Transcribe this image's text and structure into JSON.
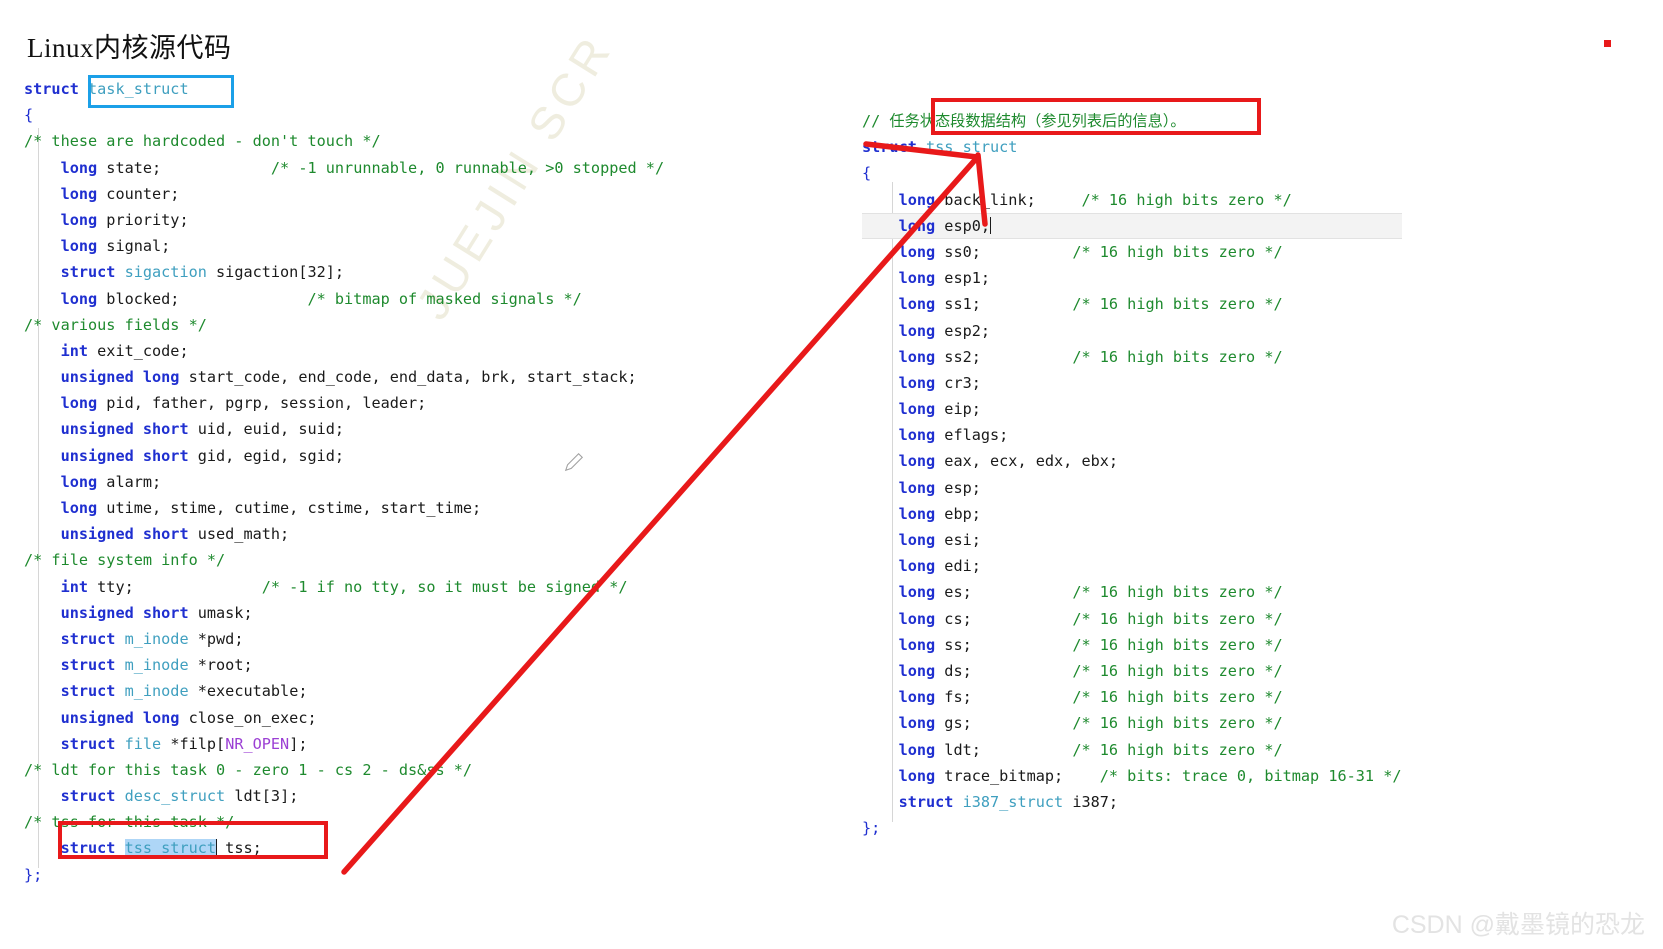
{
  "title": "Linux内核源代码",
  "colors": {
    "keyword": "#1f2fd0",
    "type": "#3f9fbf",
    "comment": "#1e8a2e",
    "macro": "#9b3fd4",
    "annotation_red": "#e8191a",
    "annotation_blue": "#1ba0e8",
    "selection": "#aed6f7"
  },
  "annotations": {
    "blue_box_target": "task_struct",
    "red_box_left_target": "struct tss_struct tss;",
    "red_box_right_target": "任务状态段数据结构（参见列表后的信息）。",
    "arrow": "red-arrow-from-tss-field-to-tss_struct-definition",
    "red_dot": "red-dot-marker"
  },
  "left_pane": {
    "name": "task_struct-source",
    "lines": [
      {
        "indent": 0,
        "segments": [
          {
            "t": "struct ",
            "c": "kw"
          },
          {
            "t": "task_struct",
            "c": "typ"
          }
        ]
      },
      {
        "indent": 0,
        "segments": [
          {
            "t": "{",
            "c": "br"
          }
        ]
      },
      {
        "indent": 0,
        "segments": [
          {
            "t": "/* these are hardcoded - don't touch */",
            "c": "cmt"
          }
        ]
      },
      {
        "indent": 1,
        "segments": [
          {
            "t": "long ",
            "c": "kw"
          },
          {
            "t": "state;",
            "c": "id"
          },
          {
            "t": "            ",
            "c": "id"
          },
          {
            "t": "/* -1 unrunnable, 0 runnable, >0 stopped */",
            "c": "cmt"
          }
        ]
      },
      {
        "indent": 1,
        "segments": [
          {
            "t": "long ",
            "c": "kw"
          },
          {
            "t": "counter;",
            "c": "id"
          }
        ]
      },
      {
        "indent": 1,
        "segments": [
          {
            "t": "long ",
            "c": "kw"
          },
          {
            "t": "priority;",
            "c": "id"
          }
        ]
      },
      {
        "indent": 1,
        "segments": [
          {
            "t": "long ",
            "c": "kw"
          },
          {
            "t": "signal;",
            "c": "id"
          }
        ]
      },
      {
        "indent": 1,
        "segments": [
          {
            "t": "struct ",
            "c": "kw"
          },
          {
            "t": "sigaction",
            "c": "typ"
          },
          {
            "t": " sigaction[",
            "c": "id"
          },
          {
            "t": "32",
            "c": "num"
          },
          {
            "t": "];",
            "c": "id"
          }
        ]
      },
      {
        "indent": 1,
        "segments": [
          {
            "t": "long ",
            "c": "kw"
          },
          {
            "t": "blocked;",
            "c": "id"
          },
          {
            "t": "              ",
            "c": "id"
          },
          {
            "t": "/* bitmap of masked signals */",
            "c": "cmt"
          }
        ]
      },
      {
        "indent": 0,
        "segments": [
          {
            "t": "/* various fields */",
            "c": "cmt"
          }
        ]
      },
      {
        "indent": 1,
        "segments": [
          {
            "t": "int ",
            "c": "kw"
          },
          {
            "t": "exit_code;",
            "c": "id"
          }
        ]
      },
      {
        "indent": 1,
        "segments": [
          {
            "t": "unsigned long ",
            "c": "kw"
          },
          {
            "t": "start_code, end_code, end_data, brk, start_stack;",
            "c": "id"
          }
        ]
      },
      {
        "indent": 1,
        "segments": [
          {
            "t": "long ",
            "c": "kw"
          },
          {
            "t": "pid, father, pgrp, session, leader;",
            "c": "id"
          }
        ]
      },
      {
        "indent": 1,
        "segments": [
          {
            "t": "unsigned short ",
            "c": "kw"
          },
          {
            "t": "uid, euid, suid;",
            "c": "id"
          }
        ]
      },
      {
        "indent": 1,
        "segments": [
          {
            "t": "unsigned short ",
            "c": "kw"
          },
          {
            "t": "gid, egid, sgid;",
            "c": "id"
          }
        ]
      },
      {
        "indent": 1,
        "segments": [
          {
            "t": "long ",
            "c": "kw"
          },
          {
            "t": "alarm;",
            "c": "id"
          }
        ]
      },
      {
        "indent": 1,
        "segments": [
          {
            "t": "long ",
            "c": "kw"
          },
          {
            "t": "utime, stime, cutime, cstime, start_time;",
            "c": "id"
          }
        ]
      },
      {
        "indent": 1,
        "segments": [
          {
            "t": "unsigned short ",
            "c": "kw"
          },
          {
            "t": "used_math;",
            "c": "id"
          }
        ]
      },
      {
        "indent": 0,
        "segments": [
          {
            "t": "/* file system info */",
            "c": "cmt"
          }
        ]
      },
      {
        "indent": 1,
        "segments": [
          {
            "t": "int ",
            "c": "kw"
          },
          {
            "t": "tty;",
            "c": "id"
          },
          {
            "t": "              ",
            "c": "id"
          },
          {
            "t": "/* -1 if no tty, so it must be signed */",
            "c": "cmt"
          }
        ]
      },
      {
        "indent": 1,
        "segments": [
          {
            "t": "unsigned short ",
            "c": "kw"
          },
          {
            "t": "umask;",
            "c": "id"
          }
        ]
      },
      {
        "indent": 1,
        "segments": [
          {
            "t": "struct ",
            "c": "kw"
          },
          {
            "t": "m_inode",
            "c": "typ"
          },
          {
            "t": " *pwd;",
            "c": "id"
          }
        ]
      },
      {
        "indent": 1,
        "segments": [
          {
            "t": "struct ",
            "c": "kw"
          },
          {
            "t": "m_inode",
            "c": "typ"
          },
          {
            "t": " *root;",
            "c": "id"
          }
        ]
      },
      {
        "indent": 1,
        "segments": [
          {
            "t": "struct ",
            "c": "kw"
          },
          {
            "t": "m_inode",
            "c": "typ"
          },
          {
            "t": " *executable;",
            "c": "id"
          }
        ]
      },
      {
        "indent": 1,
        "segments": [
          {
            "t": "unsigned long ",
            "c": "kw"
          },
          {
            "t": "close_on_exec;",
            "c": "id"
          }
        ]
      },
      {
        "indent": 1,
        "segments": [
          {
            "t": "struct ",
            "c": "kw"
          },
          {
            "t": "file",
            "c": "typ"
          },
          {
            "t": " *filp[",
            "c": "id"
          },
          {
            "t": "NR_OPEN",
            "c": "mac"
          },
          {
            "t": "];",
            "c": "id"
          }
        ]
      },
      {
        "indent": 0,
        "segments": [
          {
            "t": "/* ldt for this task 0 - zero 1 - cs 2 - ds&ss */",
            "c": "cmt"
          }
        ]
      },
      {
        "indent": 1,
        "segments": [
          {
            "t": "struct ",
            "c": "kw"
          },
          {
            "t": "desc_struct",
            "c": "typ"
          },
          {
            "t": " ldt[",
            "c": "id"
          },
          {
            "t": "3",
            "c": "num"
          },
          {
            "t": "];",
            "c": "id"
          }
        ]
      },
      {
        "indent": 0,
        "segments": [
          {
            "t": "/* tss for this task */",
            "c": "cmt"
          }
        ]
      },
      {
        "indent": 1,
        "segments": [
          {
            "t": "struct ",
            "c": "kw"
          },
          {
            "t": "tss_struct",
            "c": "typ sel"
          },
          {
            "t": "|caret|",
            "c": "caret"
          },
          {
            "t": " tss;",
            "c": "id"
          }
        ]
      },
      {
        "indent": 0,
        "segments": [
          {
            "t": "};",
            "c": "br"
          }
        ]
      }
    ]
  },
  "right_pane": {
    "name": "tss_struct-source",
    "lines": [
      {
        "indent": 0,
        "segments": [
          {
            "t": "// 任务状态段数据结构（参见列表后的信息）。",
            "c": "cmt"
          }
        ]
      },
      {
        "indent": 0,
        "segments": [
          {
            "t": "struct ",
            "c": "kw"
          },
          {
            "t": "tss_struct",
            "c": "typ"
          }
        ]
      },
      {
        "indent": 0,
        "segments": [
          {
            "t": "{",
            "c": "br"
          }
        ]
      },
      {
        "indent": 1,
        "segments": [
          {
            "t": "long ",
            "c": "kw"
          },
          {
            "t": "back_link;",
            "c": "id"
          },
          {
            "t": "     ",
            "c": "id"
          },
          {
            "t": "/* 16 high bits zero */",
            "c": "cmt"
          }
        ]
      },
      {
        "indent": 1,
        "current": true,
        "segments": [
          {
            "t": "long ",
            "c": "kw"
          },
          {
            "t": "esp0;",
            "c": "id"
          },
          {
            "t": "|caret|",
            "c": "caret"
          }
        ]
      },
      {
        "indent": 1,
        "segments": [
          {
            "t": "long ",
            "c": "kw"
          },
          {
            "t": "ss0;",
            "c": "id"
          },
          {
            "t": "          ",
            "c": "id"
          },
          {
            "t": "/* 16 high bits zero */",
            "c": "cmt"
          }
        ]
      },
      {
        "indent": 1,
        "segments": [
          {
            "t": "long ",
            "c": "kw"
          },
          {
            "t": "esp1;",
            "c": "id"
          }
        ]
      },
      {
        "indent": 1,
        "segments": [
          {
            "t": "long ",
            "c": "kw"
          },
          {
            "t": "ss1;",
            "c": "id"
          },
          {
            "t": "          ",
            "c": "id"
          },
          {
            "t": "/* 16 high bits zero */",
            "c": "cmt"
          }
        ]
      },
      {
        "indent": 1,
        "segments": [
          {
            "t": "long ",
            "c": "kw"
          },
          {
            "t": "esp2;",
            "c": "id"
          }
        ]
      },
      {
        "indent": 1,
        "segments": [
          {
            "t": "long ",
            "c": "kw"
          },
          {
            "t": "ss2;",
            "c": "id"
          },
          {
            "t": "          ",
            "c": "id"
          },
          {
            "t": "/* 16 high bits zero */",
            "c": "cmt"
          }
        ]
      },
      {
        "indent": 1,
        "segments": [
          {
            "t": "long ",
            "c": "kw"
          },
          {
            "t": "cr3;",
            "c": "id"
          }
        ]
      },
      {
        "indent": 1,
        "segments": [
          {
            "t": "long ",
            "c": "kw"
          },
          {
            "t": "eip;",
            "c": "id"
          }
        ]
      },
      {
        "indent": 1,
        "segments": [
          {
            "t": "long ",
            "c": "kw"
          },
          {
            "t": "eflags;",
            "c": "id"
          }
        ]
      },
      {
        "indent": 1,
        "segments": [
          {
            "t": "long ",
            "c": "kw"
          },
          {
            "t": "eax, ecx, edx, ebx;",
            "c": "id"
          }
        ]
      },
      {
        "indent": 1,
        "segments": [
          {
            "t": "long ",
            "c": "kw"
          },
          {
            "t": "esp;",
            "c": "id"
          }
        ]
      },
      {
        "indent": 1,
        "segments": [
          {
            "t": "long ",
            "c": "kw"
          },
          {
            "t": "ebp;",
            "c": "id"
          }
        ]
      },
      {
        "indent": 1,
        "segments": [
          {
            "t": "long ",
            "c": "kw"
          },
          {
            "t": "esi;",
            "c": "id"
          }
        ]
      },
      {
        "indent": 1,
        "segments": [
          {
            "t": "long ",
            "c": "kw"
          },
          {
            "t": "edi;",
            "c": "id"
          }
        ]
      },
      {
        "indent": 1,
        "segments": [
          {
            "t": "long ",
            "c": "kw"
          },
          {
            "t": "es;",
            "c": "id"
          },
          {
            "t": "           ",
            "c": "id"
          },
          {
            "t": "/* 16 high bits zero */",
            "c": "cmt"
          }
        ]
      },
      {
        "indent": 1,
        "segments": [
          {
            "t": "long ",
            "c": "kw"
          },
          {
            "t": "cs;",
            "c": "id"
          },
          {
            "t": "           ",
            "c": "id"
          },
          {
            "t": "/* 16 high bits zero */",
            "c": "cmt"
          }
        ]
      },
      {
        "indent": 1,
        "segments": [
          {
            "t": "long ",
            "c": "kw"
          },
          {
            "t": "ss;",
            "c": "id"
          },
          {
            "t": "           ",
            "c": "id"
          },
          {
            "t": "/* 16 high bits zero */",
            "c": "cmt"
          }
        ]
      },
      {
        "indent": 1,
        "segments": [
          {
            "t": "long ",
            "c": "kw"
          },
          {
            "t": "ds;",
            "c": "id"
          },
          {
            "t": "           ",
            "c": "id"
          },
          {
            "t": "/* 16 high bits zero */",
            "c": "cmt"
          }
        ]
      },
      {
        "indent": 1,
        "segments": [
          {
            "t": "long ",
            "c": "kw"
          },
          {
            "t": "fs;",
            "c": "id"
          },
          {
            "t": "           ",
            "c": "id"
          },
          {
            "t": "/* 16 high bits zero */",
            "c": "cmt"
          }
        ]
      },
      {
        "indent": 1,
        "segments": [
          {
            "t": "long ",
            "c": "kw"
          },
          {
            "t": "gs;",
            "c": "id"
          },
          {
            "t": "           ",
            "c": "id"
          },
          {
            "t": "/* 16 high bits zero */",
            "c": "cmt"
          }
        ]
      },
      {
        "indent": 1,
        "segments": [
          {
            "t": "long ",
            "c": "kw"
          },
          {
            "t": "ldt;",
            "c": "id"
          },
          {
            "t": "          ",
            "c": "id"
          },
          {
            "t": "/* 16 high bits zero */",
            "c": "cmt"
          }
        ]
      },
      {
        "indent": 1,
        "segments": [
          {
            "t": "long ",
            "c": "kw"
          },
          {
            "t": "trace_bitmap;",
            "c": "id"
          },
          {
            "t": "    ",
            "c": "id"
          },
          {
            "t": "/* bits: trace 0, bitmap 16-31 */",
            "c": "cmt"
          }
        ]
      },
      {
        "indent": 1,
        "segments": [
          {
            "t": "struct ",
            "c": "kw"
          },
          {
            "t": "i387_struct",
            "c": "typ"
          },
          {
            "t": " i387;",
            "c": "id"
          }
        ]
      },
      {
        "indent": 0,
        "segments": [
          {
            "t": "};",
            "c": "br"
          }
        ]
      }
    ]
  },
  "watermarks": {
    "diagonal": "JUEJIN SCR",
    "csdn": "CSDN @戴墨镜的恐龙"
  }
}
